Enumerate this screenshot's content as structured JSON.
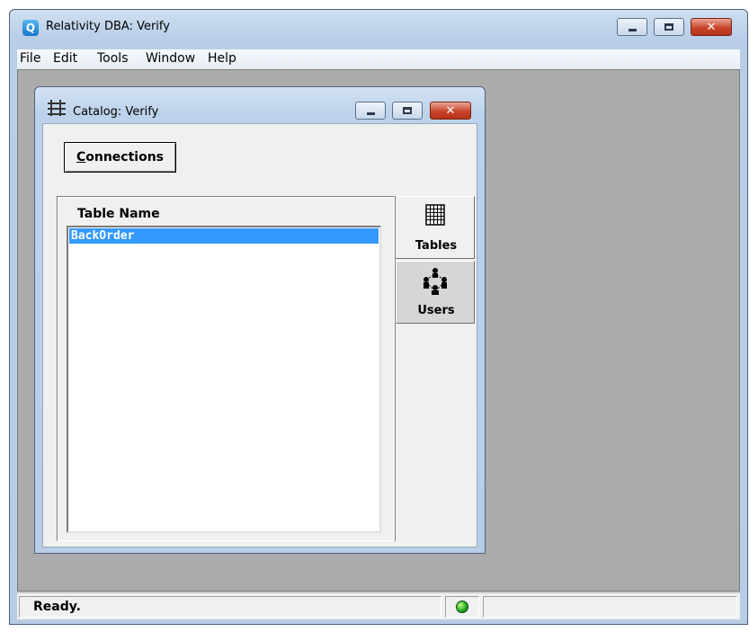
{
  "app": {
    "title": "Relativity DBA: Verify",
    "icon": "relativity-app-icon"
  },
  "menu": {
    "items": [
      "File",
      "Edit",
      "Tools",
      "Window",
      "Help"
    ]
  },
  "catalog": {
    "title": "Catalog: Verify",
    "connections_button": {
      "mnemonic": "C",
      "rest": "onnections"
    },
    "table": {
      "header": "Table Name",
      "rows": [
        "BackOrder"
      ],
      "selected_index": 0
    },
    "tabs": [
      {
        "label": "Tables",
        "icon": "grid-icon",
        "active": true
      },
      {
        "label": "Users",
        "icon": "users-icon",
        "active": false
      }
    ]
  },
  "status": {
    "text": "Ready.",
    "indicator_color": "#1ea51e"
  },
  "colors": {
    "selection": "#3399ff",
    "mdi_background": "#ababab",
    "close_button": "#c9442a"
  }
}
